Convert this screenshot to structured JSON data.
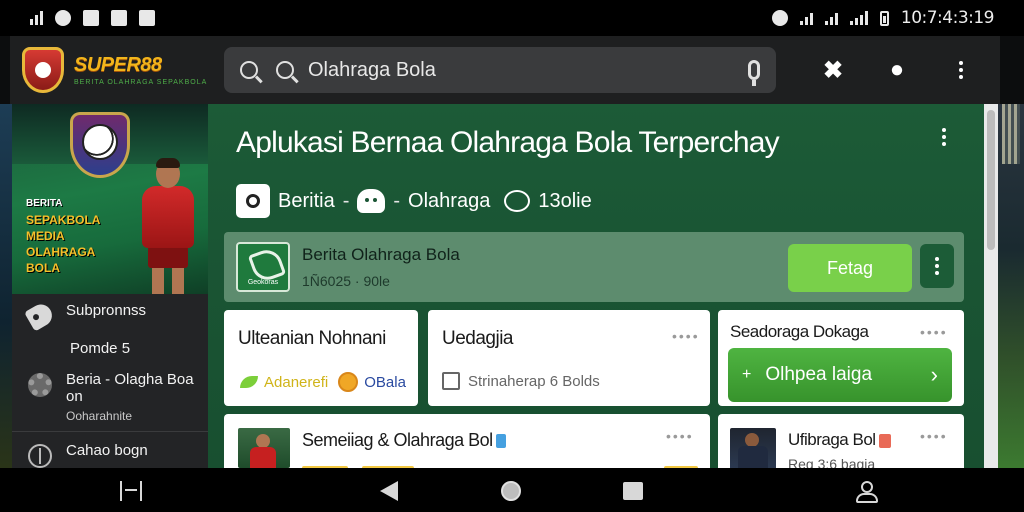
{
  "status_bar": {
    "time": "10:7:4:3:19",
    "left_icons": [
      "signal-bars-icon",
      "minus-circle-icon",
      "notification-icon",
      "accessibility-icon",
      "gallery-icon"
    ],
    "right_icons": [
      "alarm-icon",
      "wifi-icon",
      "wifi-icon",
      "cell-signal-icon",
      "battery-icon"
    ]
  },
  "app_bar": {
    "brand_name": "SUPER88",
    "brand_tagline": "BERITA OLAHRAGA SEPAKBOLA",
    "search_value": "Olahraga Bola",
    "actions": [
      "close-cross-icon",
      "chat-bubble-icon",
      "overflow-menu-icon"
    ]
  },
  "sidebar": {
    "promo_lines": [
      "BERITA",
      "SEPAKBOLA",
      "MEDIA",
      "OLAHRAGA",
      "BOLA"
    ],
    "items": [
      {
        "label": "Subpronnss",
        "icon": "tag-icon"
      },
      {
        "label": "Pomde 5",
        "icon": ""
      },
      {
        "label": "Beria - Olagha Boa on",
        "sub": "Ooharahnite",
        "icon": "gear-icon"
      },
      {
        "label": "Cahao bogn",
        "icon": "timer-icon"
      }
    ]
  },
  "main": {
    "title": "Aplukasi Bernaa Olahraga Bola Terperchay",
    "breadcrumb": {
      "item1": "Beritia",
      "sep": "-",
      "item2": "Olahraga",
      "item3": "13olie"
    },
    "feature_card": {
      "logo_text": "Geokoras",
      "title": "Berita Olahraga Bola",
      "subtitle": "1Ñ6025 · 90le",
      "button_label": "Fetag"
    },
    "cards": [
      {
        "title": "Ulteanian Nohnani",
        "meta_a": "Adanerefi",
        "meta_b": "OBala"
      },
      {
        "title": "Uedagjia",
        "meta": "Strinaherap 6 Bolds"
      },
      {
        "title": "Seadoraga Dokaga",
        "button_label": "Olhpea laiga"
      },
      {
        "title": "Semeiiag & Olahraga Bol"
      },
      {
        "title": "Ufibraga Bol",
        "subtitle": "Reg 3;6 bagia"
      }
    ],
    "card_dots": "••••"
  },
  "colors": {
    "accent_green": "#79d04a",
    "cta_green": "#37932c",
    "brand_gold": "#f2b51b",
    "main_bg": "#1a5534"
  },
  "nav_bar": [
    "recent-apps-icon",
    "back-icon",
    "home-icon",
    "overview-icon",
    "person-icon"
  ]
}
